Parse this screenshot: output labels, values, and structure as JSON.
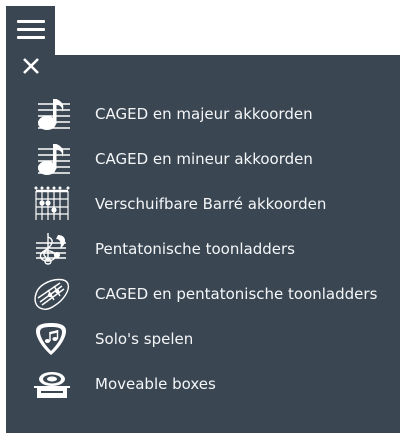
{
  "menu": {
    "items": [
      {
        "label": "CAGED en majeur akkoorden",
        "icon": "music-note-staff-major-icon"
      },
      {
        "label": "CAGED en mineur akkoorden",
        "icon": "music-note-staff-minor-icon"
      },
      {
        "label": "Verschuifbare Barré akkoorden",
        "icon": "chord-diagram-icon"
      },
      {
        "label": "Pentatonische toonladders",
        "icon": "clef-scale-icon"
      },
      {
        "label": "CAGED en pentatonische toonladders",
        "icon": "guitar-fretboard-icon"
      },
      {
        "label": "Solo's spelen",
        "icon": "guitar-pick-icon"
      },
      {
        "label": "Moveable boxes",
        "icon": "box-icon"
      }
    ]
  },
  "colors": {
    "panel": "#3a4652",
    "text": "#f4f6f8",
    "icon": "#ffffff"
  }
}
